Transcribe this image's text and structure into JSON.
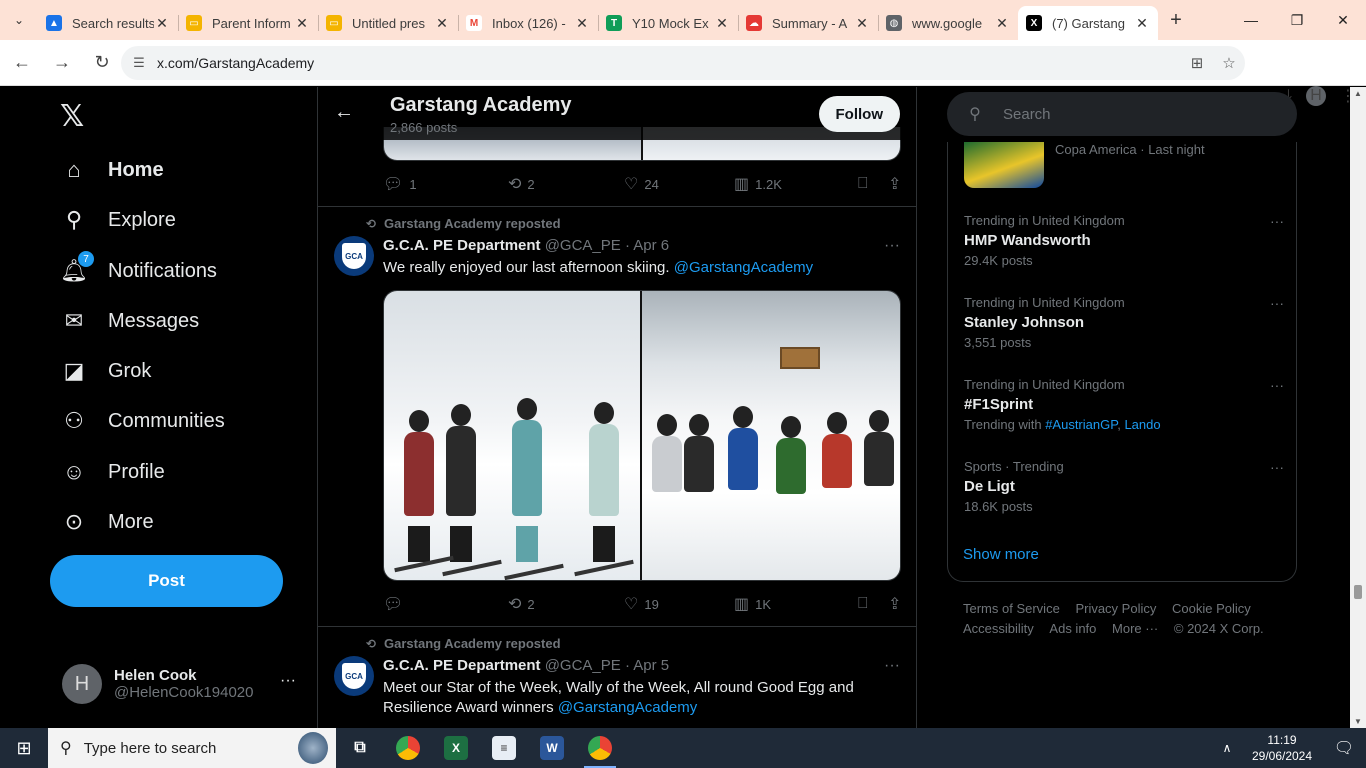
{
  "browser": {
    "tabs": [
      {
        "title": "Search results",
        "favicon": "google-drive-icon",
        "color": "#1a73e8"
      },
      {
        "title": "Parent Inform",
        "favicon": "google-slides-icon",
        "color": "#f4b400"
      },
      {
        "title": "Untitled pres",
        "favicon": "google-slides-icon",
        "color": "#f4b400"
      },
      {
        "title": "Inbox (126) -",
        "favicon": "gmail-icon",
        "color": "#ea4335"
      },
      {
        "title": "Y10 Mock Ex",
        "favicon": "google-sheets-icon",
        "color": "#0f9d58"
      },
      {
        "title": "Summary - A",
        "favicon": "cloud-icon",
        "color": "#e53935"
      },
      {
        "title": "www.google",
        "favicon": "globe-icon",
        "color": "#5f6368"
      },
      {
        "title": "(7) Garstang",
        "favicon": "x-icon",
        "color": "#000000"
      }
    ],
    "url": "x.com/GarstangAcademy",
    "profile_initial": "H"
  },
  "nav": {
    "items": [
      {
        "label": "Home"
      },
      {
        "label": "Explore"
      },
      {
        "label": "Notifications",
        "badge": "7"
      },
      {
        "label": "Messages"
      },
      {
        "label": "Grok"
      },
      {
        "label": "Communities"
      },
      {
        "label": "Profile"
      },
      {
        "label": "More"
      }
    ],
    "post_label": "Post",
    "account": {
      "name": "Helen Cook",
      "handle": "@HelenCook194020",
      "initial": "H"
    }
  },
  "header": {
    "title": "Garstang Academy",
    "subtitle": "2,866 posts",
    "follow_label": "Follow"
  },
  "tweets": [
    {
      "actions": {
        "replies": "1",
        "reposts": "2",
        "likes": "24",
        "views": "1.2K"
      }
    },
    {
      "repost_label": "Garstang Academy reposted",
      "name": "G.C.A. PE Department",
      "meta": "@GCA_PE · Apr 6",
      "text": "We really enjoyed our last afternoon skiing.",
      "mention": "@GarstangAcademy",
      "actions": {
        "replies": "",
        "reposts": "2",
        "likes": "19",
        "views": "1K"
      }
    },
    {
      "repost_label": "Garstang Academy reposted",
      "name": "G.C.A. PE Department",
      "meta": "@GCA_PE · Apr 5",
      "text": "Meet our Star of the Week, Wally of the Week, All round Good Egg and Resilience Award winners",
      "mention": "@GarstangAcademy"
    }
  ],
  "sidebar": {
    "search_placeholder": "Search",
    "top_item_meta": "Copa America · Last night",
    "trends": [
      {
        "context": "Trending in United Kingdom",
        "name": "HMP Wandsworth",
        "count": "29.4K posts"
      },
      {
        "context": "Trending in United Kingdom",
        "name": "Stanley Johnson",
        "count": "3,551 posts"
      },
      {
        "context": "Trending in United Kingdom",
        "name": "#F1Sprint",
        "count_prefix": "Trending with",
        "tags": [
          "#AustrianGP",
          "Lando"
        ]
      },
      {
        "context": "Sports · Trending",
        "name": "De Ligt",
        "count": "18.6K posts"
      }
    ],
    "show_more": "Show more",
    "footer": [
      "Terms of Service",
      "Privacy Policy",
      "Cookie Policy",
      "Accessibility",
      "Ads info",
      "More ···",
      "© 2024 X Corp."
    ]
  },
  "taskbar": {
    "search_placeholder": "Type here to search",
    "time": "11:19",
    "date": "29/06/2024"
  }
}
